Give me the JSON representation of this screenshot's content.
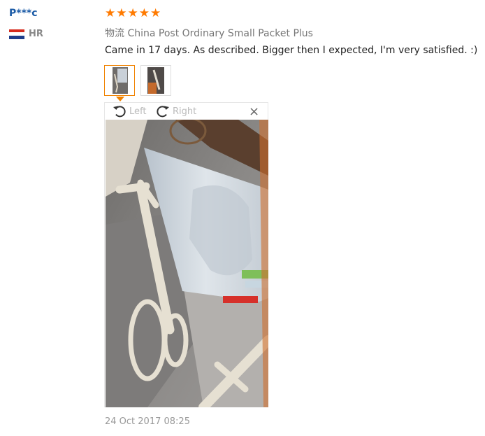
{
  "user": {
    "name": "P***c",
    "country_code": "HR"
  },
  "review": {
    "stars": 5,
    "logistics": "物流 China Post Ordinary Small Packet Plus",
    "text": "Came in 17 days. As described. Bigger then I expected, I'm very satisfied. :)",
    "date": "24 Oct 2017 08:25"
  },
  "viewer": {
    "rotate_left": "Left",
    "rotate_right": "Right",
    "close": "×"
  },
  "colors": {
    "accent": "#f08200",
    "star": "#ff7a00",
    "username": "#1a5aa6"
  },
  "icons": {
    "star": "star-icon",
    "flag": "croatia-flag-icon",
    "rotate_left": "rotate-left-icon",
    "rotate_right": "rotate-right-icon",
    "close": "close-icon"
  }
}
